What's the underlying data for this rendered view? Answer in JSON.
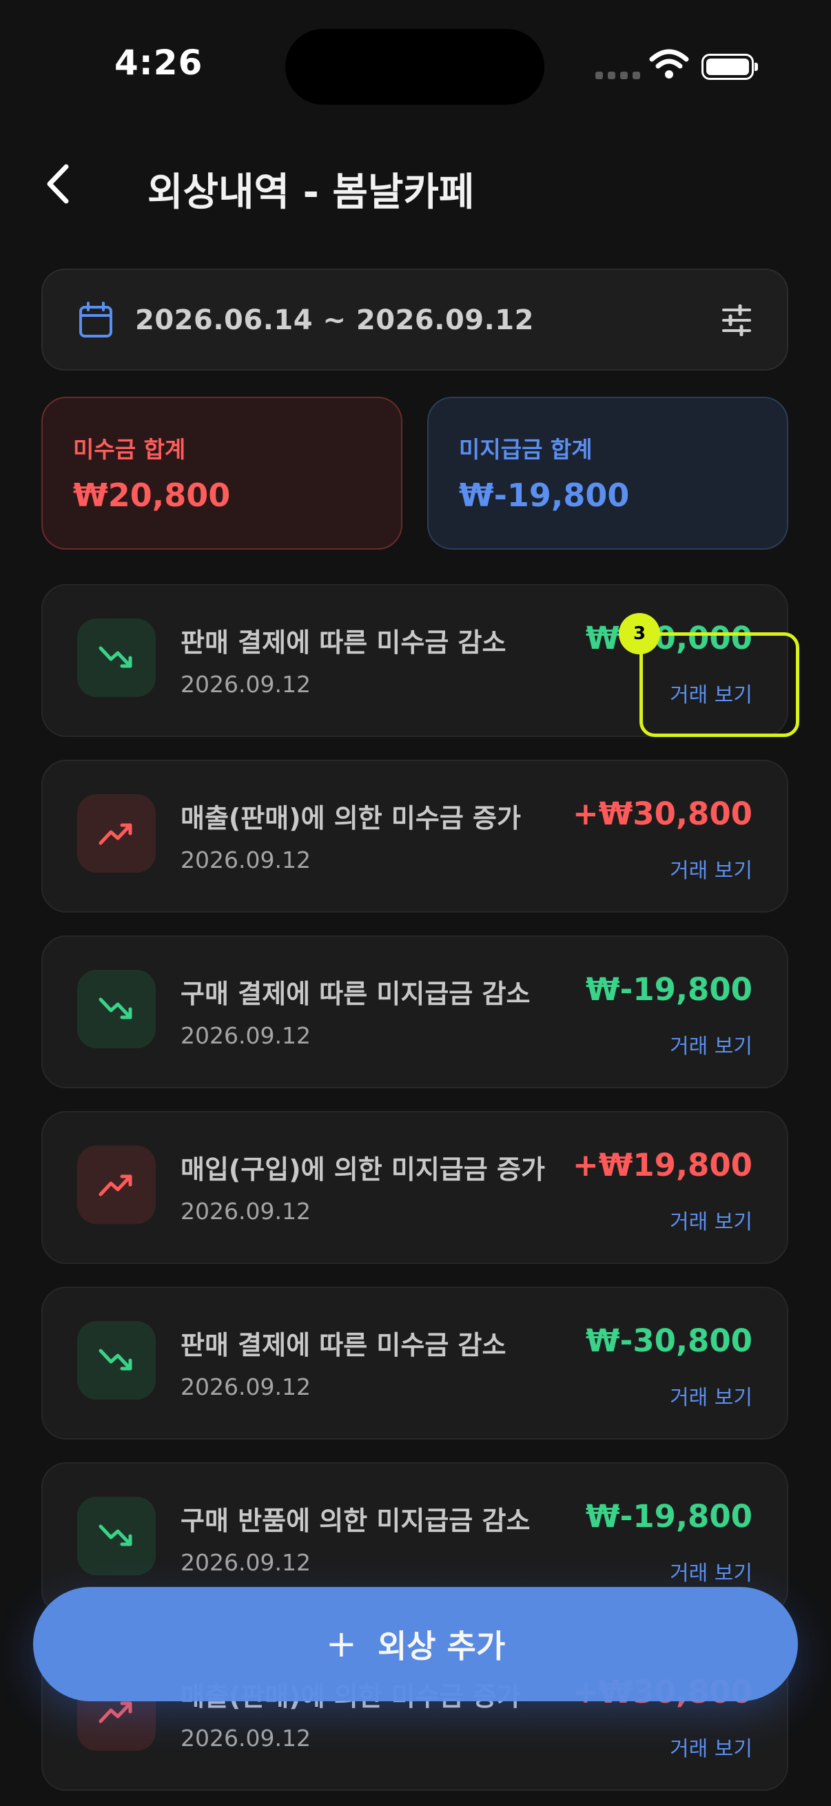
{
  "status_bar": {
    "time": "4:26"
  },
  "header": {
    "title": "외상내역 - 봄날카페"
  },
  "date_range": {
    "text": "2026.06.14 ~ 2026.09.12"
  },
  "summary": {
    "receivable": {
      "label": "미수금 합계",
      "value": "₩20,800"
    },
    "payable": {
      "label": "미지급금 합계",
      "value": "₩-19,800"
    }
  },
  "transactions": [
    {
      "title": "판매 결제에 따른 미수금 감소",
      "date": "2026.09.12",
      "amount": "₩-30,000",
      "link": "거래 보기",
      "trend": "down"
    },
    {
      "title": "매출(판매)에 의한 미수금 증가",
      "date": "2026.09.12",
      "amount": "+₩30,800",
      "link": "거래 보기",
      "trend": "up"
    },
    {
      "title": "구매 결제에 따른 미지급금 감소",
      "date": "2026.09.12",
      "amount": "₩-19,800",
      "link": "거래 보기",
      "trend": "down"
    },
    {
      "title": "매입(구입)에 의한 미지급금 증가",
      "date": "2026.09.12",
      "amount": "+₩19,800",
      "link": "거래 보기",
      "trend": "up"
    },
    {
      "title": "판매 결제에 따른 미수금 감소",
      "date": "2026.09.12",
      "amount": "₩-30,800",
      "link": "거래 보기",
      "trend": "down"
    },
    {
      "title": "구매 반품에 의한 미지급금 감소",
      "date": "2026.09.12",
      "amount": "₩-19,800",
      "link": "거래 보기",
      "trend": "down"
    },
    {
      "title": "매출(판매)에 의한 미수금 증가",
      "date": "2026.09.12",
      "amount": "+₩30,800",
      "link": "거래 보기",
      "trend": "up"
    }
  ],
  "highlight": {
    "badge": "3"
  },
  "fab": {
    "label": "외상 추가"
  },
  "colors": {
    "accent": "#5b8ee8",
    "positive": "#3ad38a",
    "negative": "#ff5a5a",
    "highlight": "#d8f21a"
  }
}
